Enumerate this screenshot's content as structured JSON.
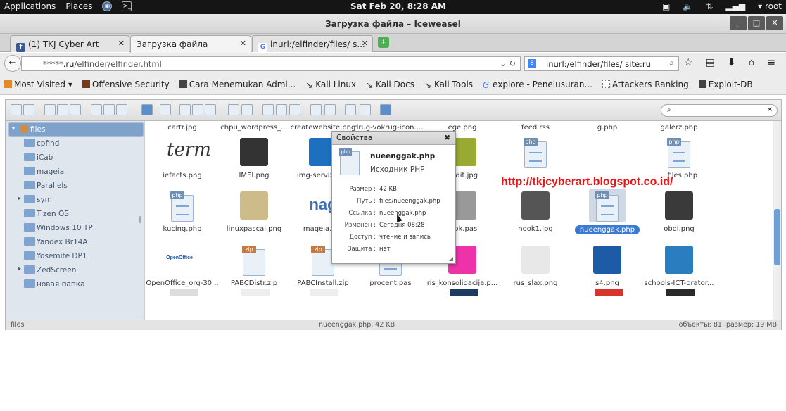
{
  "topbar": {
    "applications": "Applications",
    "places": "Places",
    "clock": "Sat Feb 20,  8:28 AM",
    "user": "root"
  },
  "window": {
    "title": "Загрузка файла – Iceweasel"
  },
  "tabs": [
    {
      "label": "(1) TKJ Cyber Art",
      "favicon": "f"
    },
    {
      "label": "Загрузка файла",
      "favicon": ""
    },
    {
      "label": "inurl:/elfinder/files/ s...",
      "favicon": "G"
    }
  ],
  "nav": {
    "url_prefix": "*****",
    "url_host": ".ru",
    "url_path": "/elfinder/elfinder.html",
    "search_value": "inurl:/elfinder/files/ site:ru",
    "search_engine": "8"
  },
  "bookmarks": [
    "Most Visited",
    "Offensive Security",
    "Cara Menemukan Admi...",
    "Kali Linux",
    "Kali Docs",
    "Kali Tools",
    "explore - Penelusuran...",
    "Attackers Ranking",
    "Exploit-DB"
  ],
  "tree": {
    "root": "files",
    "items": [
      {
        "label": "cpfind",
        "expandable": false
      },
      {
        "label": "iCab",
        "expandable": false
      },
      {
        "label": "mageia",
        "expandable": false
      },
      {
        "label": "Parallels",
        "expandable": false
      },
      {
        "label": "sym",
        "expandable": true
      },
      {
        "label": "Tizen OS",
        "expandable": false
      },
      {
        "label": "Windows 10 TP",
        "expandable": false
      },
      {
        "label": "Yandex Br14A",
        "expandable": false
      },
      {
        "label": "Yosemite DP1",
        "expandable": false
      },
      {
        "label": "ZedScreen",
        "expandable": true
      },
      {
        "label": "новая папка",
        "expandable": false
      }
    ]
  },
  "files": {
    "row0": [
      "cartr.jpg",
      "chpu_wordpress_...",
      "createwebsite.png",
      "drug-vokrug-icon.png",
      "ege.png",
      "feed.rss",
      "g.php",
      "galerz.php"
    ],
    "row1": [
      "iefacts.png",
      "IMEI.png",
      "img-servizi-h...",
      "",
      "audit.jpg",
      "",
      "",
      "...files.php"
    ],
    "row2": [
      "kucing.php",
      "linuxpascal.png",
      "mageia.p...",
      "",
      "...ok.pas",
      "nook1.jpg",
      "nueenggak.php",
      "oboi.png"
    ],
    "row3": [
      "OpenOffice_org-30...",
      "PABCDistr.zip",
      "PABCInstall.zip",
      "procent.pas",
      "ris_konsolidacija.p...",
      "rus_slax.png",
      "s4.png",
      "schools-ICT-orator..."
    ],
    "thumb_terms": "term",
    "thumb_nag": "nag",
    "thumb_oo": "OpenOffice"
  },
  "search": {
    "placeholder": ""
  },
  "statusbar": {
    "path": "files",
    "selected": "nueenggak.php, 42 KB",
    "summary": "объекты: 81, размер: 19 MB"
  },
  "dialog": {
    "title": "Свойства",
    "name": "nueenggak.php",
    "kind": "Исходник PHP",
    "props": [
      {
        "k": "Размер :",
        "v": "42 KB"
      },
      {
        "k": "Путь :",
        "v": "files/nueenggak.php"
      },
      {
        "k": "Ссылка :",
        "v": "nueenggak.php"
      },
      {
        "k": "Изменен :",
        "v": "Сегодня 08:28"
      },
      {
        "k": "Доступ :",
        "v": "чтение и запись"
      },
      {
        "k": "Защита :",
        "v": "нет"
      }
    ]
  },
  "watermark": "http://tkjcyberart.blogspot.co.id/",
  "colors": {
    "accent": "#3b7ad4",
    "watermark": "#e11111",
    "tree_bg": "#dfe6ee"
  }
}
